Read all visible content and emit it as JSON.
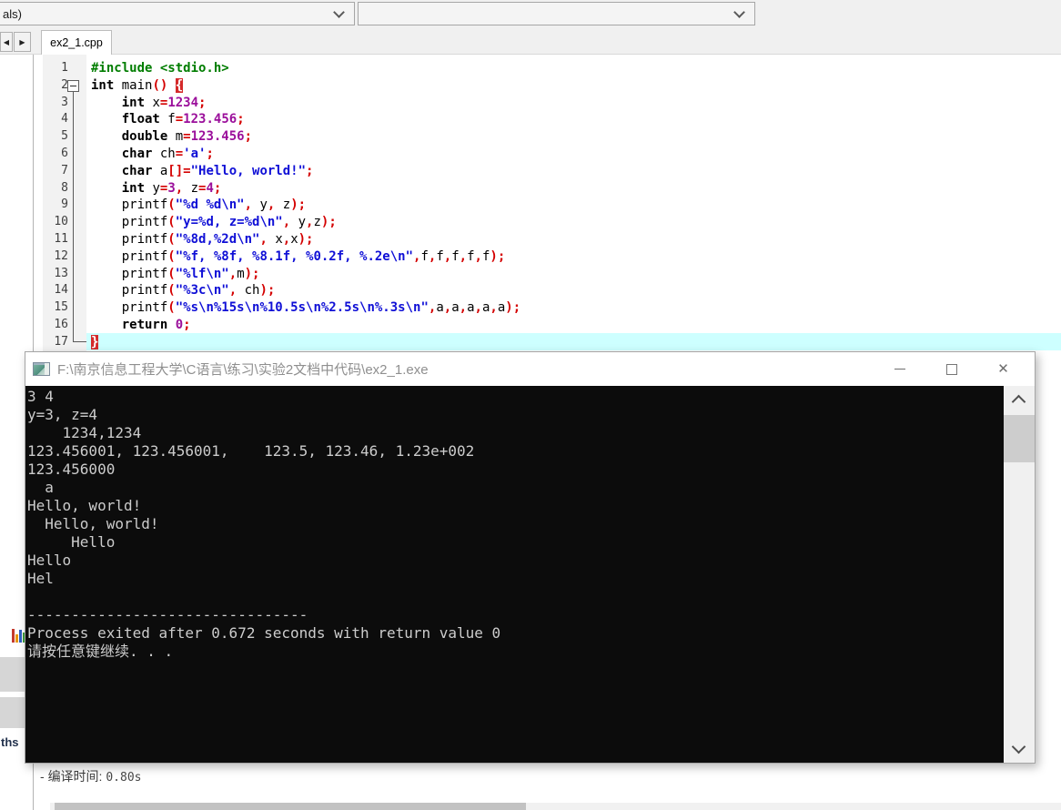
{
  "top_bar": {
    "left_dropdown_value": "als)",
    "right_dropdown_value": ""
  },
  "tab_bar": {
    "active_tab": "ex2_1.cpp",
    "scroll_left_glyph": "◀",
    "scroll_right_glyph": "▶"
  },
  "editor": {
    "current_line": 17,
    "colors": {
      "preprocessor": "#007d00",
      "string": "#0f0fd6",
      "number": "#9b0f9b",
      "symbol": "#d40000",
      "brace_highlight_bg": "#d42a2a",
      "current_line_bg": "#cdffff"
    },
    "lines": [
      {
        "num": 1,
        "segments": [
          [
            "p",
            "#include <stdio.h>"
          ]
        ]
      },
      {
        "num": 2,
        "segments": [
          [
            "k",
            "int"
          ],
          [
            "d",
            " main"
          ],
          [
            "o",
            "()"
          ],
          [
            "d",
            " "
          ],
          [
            "b",
            "{"
          ]
        ]
      },
      {
        "num": 3,
        "segments": [
          [
            "d",
            "    "
          ],
          [
            "k",
            "int"
          ],
          [
            "d",
            " x"
          ],
          [
            "o",
            "="
          ],
          [
            "n",
            "1234"
          ],
          [
            "o",
            ";"
          ]
        ]
      },
      {
        "num": 4,
        "segments": [
          [
            "d",
            "    "
          ],
          [
            "k",
            "float"
          ],
          [
            "d",
            " f"
          ],
          [
            "o",
            "="
          ],
          [
            "n",
            "123.456"
          ],
          [
            "o",
            ";"
          ]
        ]
      },
      {
        "num": 5,
        "segments": [
          [
            "d",
            "    "
          ],
          [
            "k",
            "double"
          ],
          [
            "d",
            " m"
          ],
          [
            "o",
            "="
          ],
          [
            "n",
            "123.456"
          ],
          [
            "o",
            ";"
          ]
        ]
      },
      {
        "num": 6,
        "segments": [
          [
            "d",
            "    "
          ],
          [
            "k",
            "char"
          ],
          [
            "d",
            " ch"
          ],
          [
            "o",
            "="
          ],
          [
            "s",
            "'a'"
          ],
          [
            "o",
            ";"
          ]
        ]
      },
      {
        "num": 7,
        "segments": [
          [
            "d",
            "    "
          ],
          [
            "k",
            "char"
          ],
          [
            "d",
            " a"
          ],
          [
            "o",
            "[]="
          ],
          [
            "s",
            "\"Hello, world!\""
          ],
          [
            "o",
            ";"
          ]
        ]
      },
      {
        "num": 8,
        "segments": [
          [
            "d",
            "    "
          ],
          [
            "k",
            "int"
          ],
          [
            "d",
            " y"
          ],
          [
            "o",
            "="
          ],
          [
            "n",
            "3"
          ],
          [
            "o",
            ","
          ],
          [
            "d",
            " z"
          ],
          [
            "o",
            "="
          ],
          [
            "n",
            "4"
          ],
          [
            "o",
            ";"
          ]
        ]
      },
      {
        "num": 9,
        "segments": [
          [
            "d",
            "    printf"
          ],
          [
            "o",
            "("
          ],
          [
            "s",
            "\"%d %d\\n\""
          ],
          [
            "o",
            ","
          ],
          [
            "d",
            " y"
          ],
          [
            "o",
            ","
          ],
          [
            "d",
            " z"
          ],
          [
            "o",
            ");"
          ]
        ]
      },
      {
        "num": 10,
        "segments": [
          [
            "d",
            "    printf"
          ],
          [
            "o",
            "("
          ],
          [
            "s",
            "\"y=%d, z=%d\\n\""
          ],
          [
            "o",
            ","
          ],
          [
            "d",
            " y"
          ],
          [
            "o",
            ","
          ],
          [
            "d",
            "z"
          ],
          [
            "o",
            ");"
          ]
        ]
      },
      {
        "num": 11,
        "segments": [
          [
            "d",
            "    printf"
          ],
          [
            "o",
            "("
          ],
          [
            "s",
            "\"%8d,%2d\\n\""
          ],
          [
            "o",
            ","
          ],
          [
            "d",
            " x"
          ],
          [
            "o",
            ","
          ],
          [
            "d",
            "x"
          ],
          [
            "o",
            ");"
          ]
        ]
      },
      {
        "num": 12,
        "segments": [
          [
            "d",
            "    printf"
          ],
          [
            "o",
            "("
          ],
          [
            "s",
            "\"%f, %8f, %8.1f, %0.2f, %.2e\\n\""
          ],
          [
            "o",
            ","
          ],
          [
            "d",
            "f"
          ],
          [
            "o",
            ","
          ],
          [
            "d",
            "f"
          ],
          [
            "o",
            ","
          ],
          [
            "d",
            "f"
          ],
          [
            "o",
            ","
          ],
          [
            "d",
            "f"
          ],
          [
            "o",
            ","
          ],
          [
            "d",
            "f"
          ],
          [
            "o",
            ");"
          ]
        ]
      },
      {
        "num": 13,
        "segments": [
          [
            "d",
            "    printf"
          ],
          [
            "o",
            "("
          ],
          [
            "s",
            "\"%lf\\n\""
          ],
          [
            "o",
            ","
          ],
          [
            "d",
            "m"
          ],
          [
            "o",
            ");"
          ]
        ]
      },
      {
        "num": 14,
        "segments": [
          [
            "d",
            "    printf"
          ],
          [
            "o",
            "("
          ],
          [
            "s",
            "\"%3c\\n\""
          ],
          [
            "o",
            ","
          ],
          [
            "d",
            " ch"
          ],
          [
            "o",
            ");"
          ]
        ]
      },
      {
        "num": 15,
        "segments": [
          [
            "d",
            "    printf"
          ],
          [
            "o",
            "("
          ],
          [
            "s",
            "\"%s\\n%15s\\n%10.5s\\n%2.5s\\n%.3s\\n\""
          ],
          [
            "o",
            ","
          ],
          [
            "d",
            "a"
          ],
          [
            "o",
            ","
          ],
          [
            "d",
            "a"
          ],
          [
            "o",
            ","
          ],
          [
            "d",
            "a"
          ],
          [
            "o",
            ","
          ],
          [
            "d",
            "a"
          ],
          [
            "o",
            ","
          ],
          [
            "d",
            "a"
          ],
          [
            "o",
            ");"
          ]
        ]
      },
      {
        "num": 16,
        "segments": [
          [
            "d",
            "    "
          ],
          [
            "k",
            "return"
          ],
          [
            "d",
            " "
          ],
          [
            "n",
            "0"
          ],
          [
            "o",
            ";"
          ]
        ]
      },
      {
        "num": 17,
        "segments": [
          [
            "b",
            "}"
          ]
        ]
      }
    ]
  },
  "console_window": {
    "title": "F:\\南京信息工程大学\\C语言\\练习\\实验2文档中代码\\ex2_1.exe",
    "close_glyph": "✕",
    "output_lines": [
      "3 4",
      "y=3, z=4",
      "    1234,1234",
      "123.456001, 123.456001,    123.5, 123.46, 1.23e+002",
      "123.456000",
      "  a",
      "Hello, world!",
      "  Hello, world!",
      "     Hello",
      "Hello",
      "Hel",
      "",
      "--------------------------------",
      "Process exited after 0.672 seconds with return value 0",
      "请按任意键继续. . ."
    ]
  },
  "bottom_panel": {
    "truncated_tab_label": "ths",
    "status_prefix": "- ",
    "compile_time_label": "编译时间: ",
    "compile_time_value": "0.80s"
  }
}
